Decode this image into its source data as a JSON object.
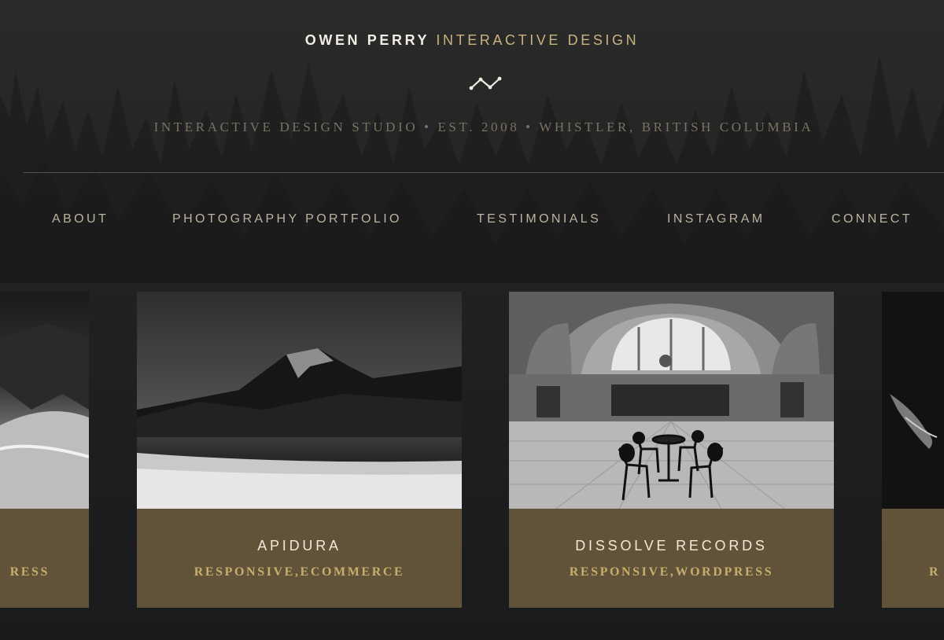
{
  "header": {
    "brand_name": "OWEN PERRY",
    "brand_suffix": "INTERACTIVE DESIGN",
    "logo_icon": "zigzag-line-icon",
    "tagline": "INTERACTIVE DESIGN STUDIO • EST. 2008 • WHISTLER, BRITISH COLUMBIA"
  },
  "nav": {
    "items": [
      {
        "label": "ABOUT"
      },
      {
        "label": "PHOTOGRAPHY PORTFOLIO"
      },
      {
        "label": "TESTIMONIALS"
      },
      {
        "label": "INSTAGRAM"
      },
      {
        "label": "CONNECT"
      }
    ]
  },
  "portfolio": {
    "cards": [
      {
        "title": "",
        "tags": "RESS"
      },
      {
        "title": "APIDURA",
        "tags": "RESPONSIVE,ECOMMERCE"
      },
      {
        "title": "DISSOLVE RECORDS",
        "tags": "RESPONSIVE,WORDPRESS"
      },
      {
        "title": "",
        "tags": "R"
      }
    ]
  },
  "colors": {
    "background": "#1b1c1e",
    "accent_gold": "#c9b37e",
    "card_panel": "#60533a",
    "nav_text": "#bcb3a1"
  }
}
